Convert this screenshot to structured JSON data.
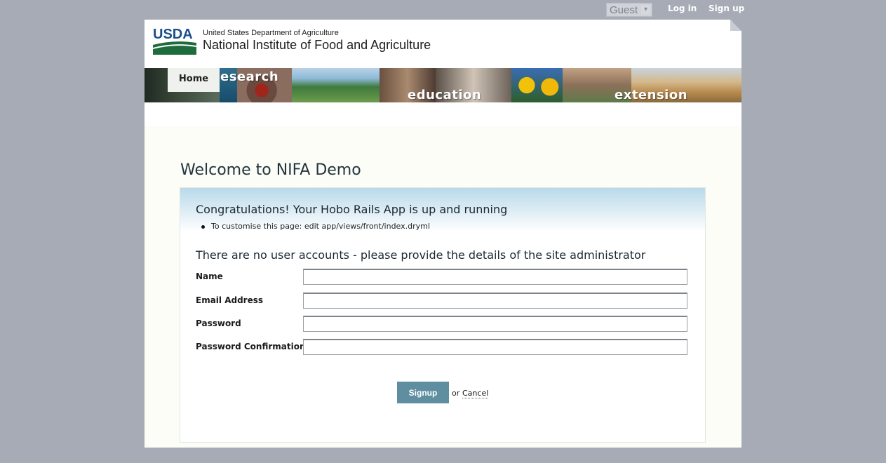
{
  "topbar": {
    "guest_select": "Guest",
    "login": "Log in",
    "signup": "Sign up"
  },
  "header": {
    "logo_text": "USDA",
    "department": "United States Department of Agriculture",
    "institute": "National Institute of Food and Agriculture"
  },
  "banner": {
    "home_tab": "Home",
    "words": {
      "research": "esearch",
      "education": "education",
      "extension": "extension"
    }
  },
  "main": {
    "title": "Welcome to NIFA Demo",
    "panel": {
      "heading": "Congratulations! Your Hobo Rails App is up and running",
      "tip": "To customise this page: edit app/views/front/index.dryml",
      "form_heading": "There are no user accounts - please provide the details of the site administrator",
      "fields": [
        {
          "label": "Name",
          "value": ""
        },
        {
          "label": "Email Address",
          "value": ""
        },
        {
          "label": "Password",
          "value": ""
        },
        {
          "label": "Password Confirmation",
          "value": ""
        }
      ],
      "submit": "Signup",
      "or": "or",
      "cancel": "Cancel"
    }
  },
  "colors": {
    "background": "#a7abb6",
    "button": "#5f8ea0",
    "usda_green": "#1e6b3c",
    "usda_blue": "#1b4f8a"
  }
}
